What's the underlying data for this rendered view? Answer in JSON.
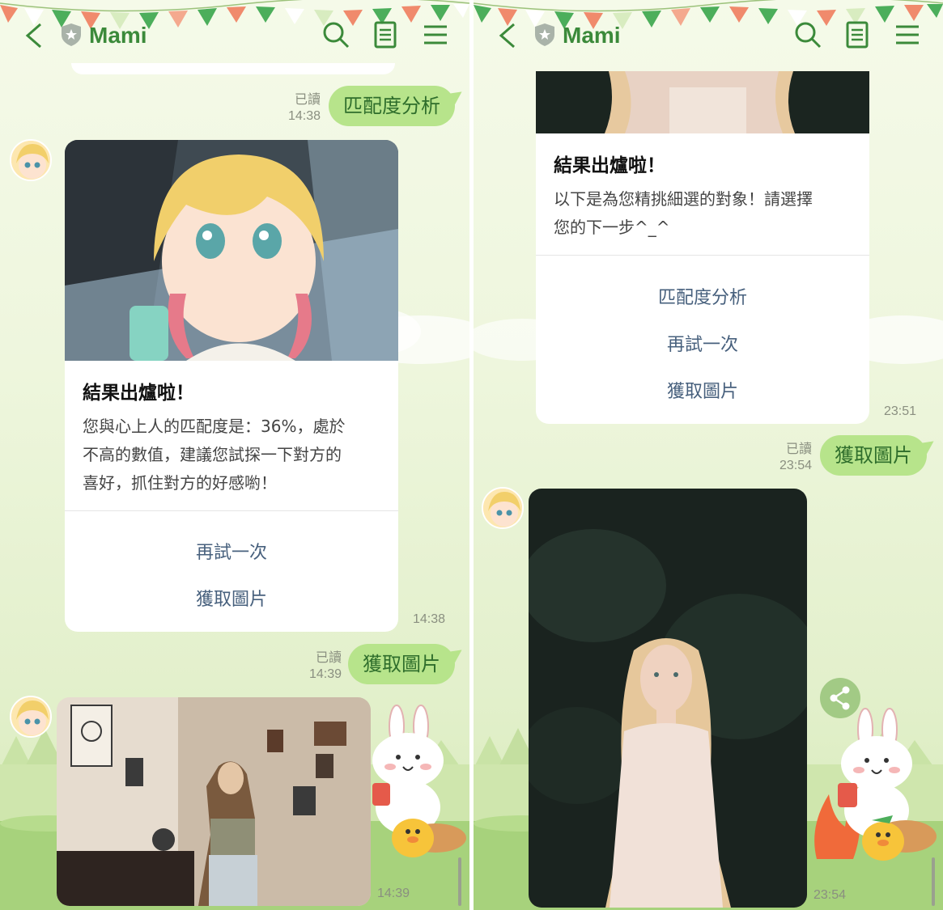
{
  "left": {
    "header": {
      "title": "Mami"
    },
    "sent1": {
      "text": "匹配度分析",
      "read": "已讀",
      "time": "14:38"
    },
    "card": {
      "title": "結果出爐啦！",
      "body": [
        "您與心上人的匹配度是：36%，處於",
        "不高的數值，建議您試探一下對方的",
        "喜好，抓住對方的好感喲！"
      ],
      "actions": [
        "再試一次",
        "獲取圖片"
      ],
      "time": "14:38"
    },
    "sent2": {
      "text": "獲取圖片",
      "read": "已讀",
      "time": "14:39"
    },
    "photo_time": "14:39"
  },
  "right": {
    "header": {
      "title": "Mami"
    },
    "card": {
      "title": "結果出爐啦！",
      "body": [
        "以下是為您精挑細選的對象！請選擇",
        "您的下一步^_^"
      ],
      "actions": [
        "匹配度分析",
        "再試一次",
        "獲取圖片"
      ],
      "time": "23:51"
    },
    "sent": {
      "text": "獲取圖片",
      "read": "已讀",
      "time": "23:54"
    },
    "photo_time": "23:54"
  },
  "colors": {
    "brand": "#3b8a3a",
    "bubble": "#b7e48b",
    "action": "#47607d"
  }
}
